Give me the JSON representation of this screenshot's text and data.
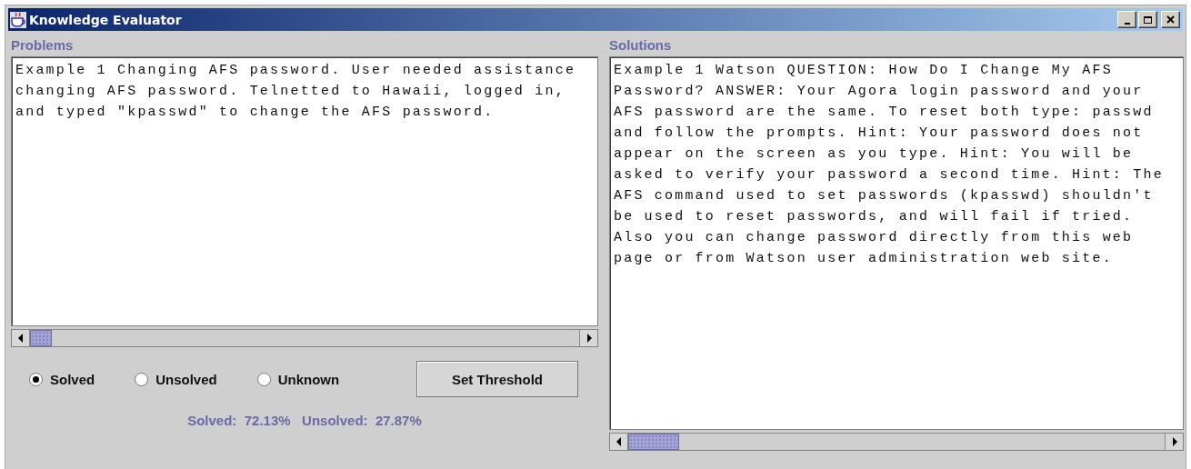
{
  "window": {
    "title": "Knowledge Evaluator"
  },
  "problems": {
    "label": "Problems",
    "text": "Example 1 Changing AFS password. User needed assistance changing AFS password. Telnetted to Hawaii, logged in, and typed \"kpasswd\" to change the AFS password."
  },
  "outcome_options": [
    {
      "label": "Solved",
      "selected": true
    },
    {
      "label": "Unsolved",
      "selected": false
    },
    {
      "label": "Unknown",
      "selected": false
    }
  ],
  "threshold_button": "Set Threshold",
  "status": "Solved:  72.13%   Unsolved:  27.87%",
  "solutions": {
    "label": "Solutions",
    "text": "Example 1 Watson QUESTION: How Do I Change My AFS Password? ANSWER: Your Agora login password and your AFS password are the same. To reset both type: passwd and follow the prompts. Hint: Your password does not appear on the screen as you type. Hint: You will be asked to verify your password a second time. Hint: The AFS command used to set passwords (kpasswd) shouldn't be used to reset passwords, and will fail if tried. Also you can change password directly from this web page or from Watson user administration web site."
  }
}
